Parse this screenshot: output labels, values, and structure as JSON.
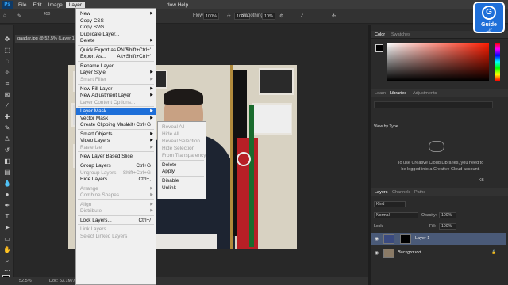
{
  "menubar": {
    "app_icon": "Ps",
    "items": [
      "File",
      "Edit",
      "Image",
      "Layer"
    ],
    "help": "dow Help"
  },
  "options": {
    "size_value": "450",
    "flow_label": "Flow:",
    "flow_value": "100%",
    "percent_value": "100%",
    "smoothing_label": "Smoothing:",
    "smoothing_value": "10%"
  },
  "document": {
    "tab_title": "qaadar.jpg @ 52.5% (Layer 1,",
    "zoom": "52.5%",
    "doc_info": "Doc: 53.1M/7"
  },
  "layer_menu": {
    "items": [
      {
        "label": "New",
        "arrow": true
      },
      {
        "label": "Copy CSS"
      },
      {
        "label": "Copy SVG"
      },
      {
        "label": "Duplicate Layer..."
      },
      {
        "label": "Delete",
        "arrow": true
      },
      {
        "sep": true
      },
      {
        "label": "Quick Export as PNG",
        "shortcut": "Shift+Ctrl+'"
      },
      {
        "label": "Export As...",
        "shortcut": "Alt+Shift+Ctrl+'"
      },
      {
        "sep": true
      },
      {
        "label": "Rename Layer..."
      },
      {
        "label": "Layer Style",
        "arrow": true
      },
      {
        "label": "Smart Filter",
        "disabled": true,
        "arrow": true
      },
      {
        "sep": true
      },
      {
        "label": "New Fill Layer",
        "arrow": true
      },
      {
        "label": "New Adjustment Layer",
        "arrow": true
      },
      {
        "label": "Layer Content Options...",
        "disabled": true
      },
      {
        "sep": true
      },
      {
        "label": "Layer Mask",
        "arrow": true,
        "highlighted": true
      },
      {
        "label": "Vector Mask",
        "arrow": true
      },
      {
        "label": "Create Clipping Mask",
        "shortcut": "Alt+Ctrl+G"
      },
      {
        "sep": true
      },
      {
        "label": "Smart Objects",
        "arrow": true
      },
      {
        "label": "Video Layers",
        "arrow": true
      },
      {
        "label": "Rasterize",
        "disabled": true,
        "arrow": true
      },
      {
        "sep": true
      },
      {
        "label": "New Layer Based Slice"
      },
      {
        "sep": true
      },
      {
        "label": "Group Layers",
        "shortcut": "Ctrl+G"
      },
      {
        "label": "Ungroup Layers",
        "shortcut": "Shift+Ctrl+G",
        "disabled": true
      },
      {
        "label": "Hide Layers",
        "shortcut": "Ctrl+,"
      },
      {
        "sep": true
      },
      {
        "label": "Arrange",
        "disabled": true,
        "arrow": true
      },
      {
        "label": "Combine Shapes",
        "disabled": true,
        "arrow": true
      },
      {
        "sep": true
      },
      {
        "label": "Align",
        "disabled": true,
        "arrow": true
      },
      {
        "label": "Distribute",
        "disabled": true,
        "arrow": true
      },
      {
        "sep": true
      },
      {
        "label": "Lock Layers...",
        "shortcut": "Ctrl+/"
      },
      {
        "sep": true
      },
      {
        "label": "Link Layers",
        "disabled": true
      },
      {
        "label": "Select Linked Layers",
        "disabled": true
      }
    ]
  },
  "mask_submenu": {
    "items": [
      {
        "label": "Reveal All",
        "disabled": true
      },
      {
        "label": "Hide All",
        "disabled": true
      },
      {
        "label": "Reveal Selection",
        "disabled": true
      },
      {
        "label": "Hide Selection",
        "disabled": true
      },
      {
        "label": "From Transparency",
        "disabled": true
      },
      {
        "sep": true
      },
      {
        "label": "Delete"
      },
      {
        "label": "Apply"
      },
      {
        "sep": true
      },
      {
        "label": "Disable"
      },
      {
        "label": "Unlink"
      }
    ]
  },
  "color_panel": {
    "tabs": [
      "Color",
      "Swatches"
    ]
  },
  "libraries_panel": {
    "tabs": [
      "Learn",
      "Libraries",
      "Adjustments"
    ],
    "view_by": "View by Type",
    "message": "To use Creative Cloud Libraries, you need to be logged into a Creative Cloud account.",
    "size": "-- KB"
  },
  "layers_panel": {
    "tabs": [
      "Layers",
      "Channels",
      "Paths"
    ],
    "kind": "Kind",
    "blend_mode": "Normal",
    "opacity_label": "Opacity:",
    "opacity": "100%",
    "lock_label": "Lock:",
    "fill_label": "Fill:",
    "fill": "100%",
    "layers": [
      {
        "name": "Layer 1",
        "selected": true
      },
      {
        "name": "Background",
        "selected": false
      }
    ]
  },
  "logo": {
    "title": "Guide",
    "subtitle": "گاید"
  }
}
